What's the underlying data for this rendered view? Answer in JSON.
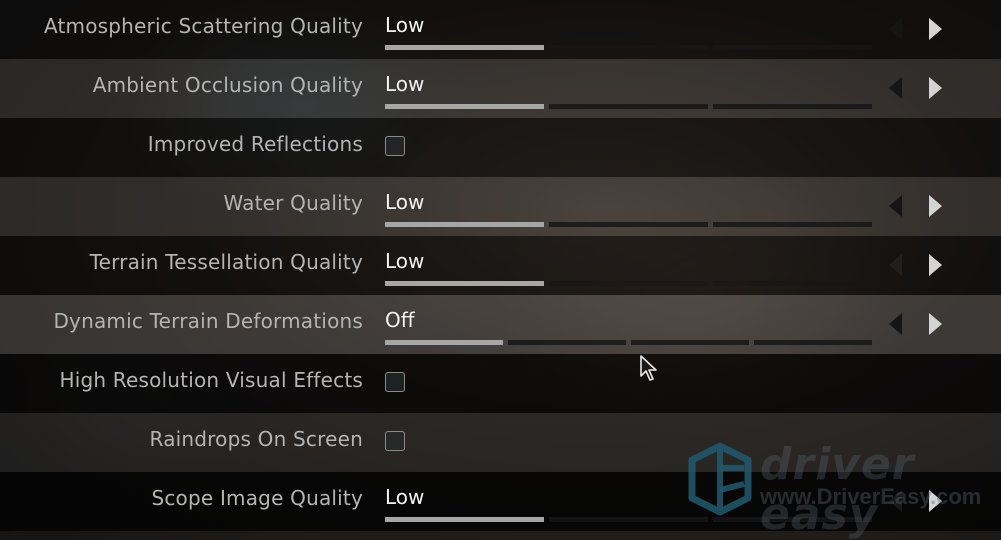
{
  "settings": [
    {
      "label": "Atmospheric Scattering Quality",
      "type": "slider",
      "value": "Low",
      "level": 1,
      "levels": 3,
      "left_arrow_enabled": true
    },
    {
      "label": "Ambient Occlusion Quality",
      "type": "slider",
      "value": "Low",
      "level": 1,
      "levels": 3,
      "left_arrow_enabled": true
    },
    {
      "label": "Improved Reflections",
      "type": "checkbox",
      "checked": false
    },
    {
      "label": "Water Quality",
      "type": "slider",
      "value": "Low",
      "level": 1,
      "levels": 3,
      "left_arrow_enabled": true
    },
    {
      "label": "Terrain Tessellation Quality",
      "type": "slider",
      "value": "Low",
      "level": 1,
      "levels": 3,
      "left_arrow_enabled": false
    },
    {
      "label": "Dynamic Terrain Deformations",
      "type": "slider",
      "value": "Off",
      "level": 1,
      "levels": 4,
      "left_arrow_enabled": true
    },
    {
      "label": "High Resolution Visual Effects",
      "type": "checkbox",
      "checked": false
    },
    {
      "label": "Raindrops On Screen",
      "type": "checkbox",
      "checked": false
    },
    {
      "label": "Scope Image Quality",
      "type": "slider",
      "value": "Low",
      "level": 1,
      "levels": 3,
      "left_arrow_enabled": true
    }
  ],
  "icons": {
    "left_arrow": "left-triangle",
    "right_arrow": "right-triangle",
    "cursor": "mouse-pointer"
  },
  "watermark": {
    "brand": "driver easy",
    "url": "www.DriverEasy.com",
    "logo_color": "#1f5a6e"
  },
  "colors": {
    "label_text": "#b4b4b4",
    "value_text": "#f2f2f2",
    "slider_active": "#a6a6a6",
    "slider_inactive": "#161616"
  }
}
